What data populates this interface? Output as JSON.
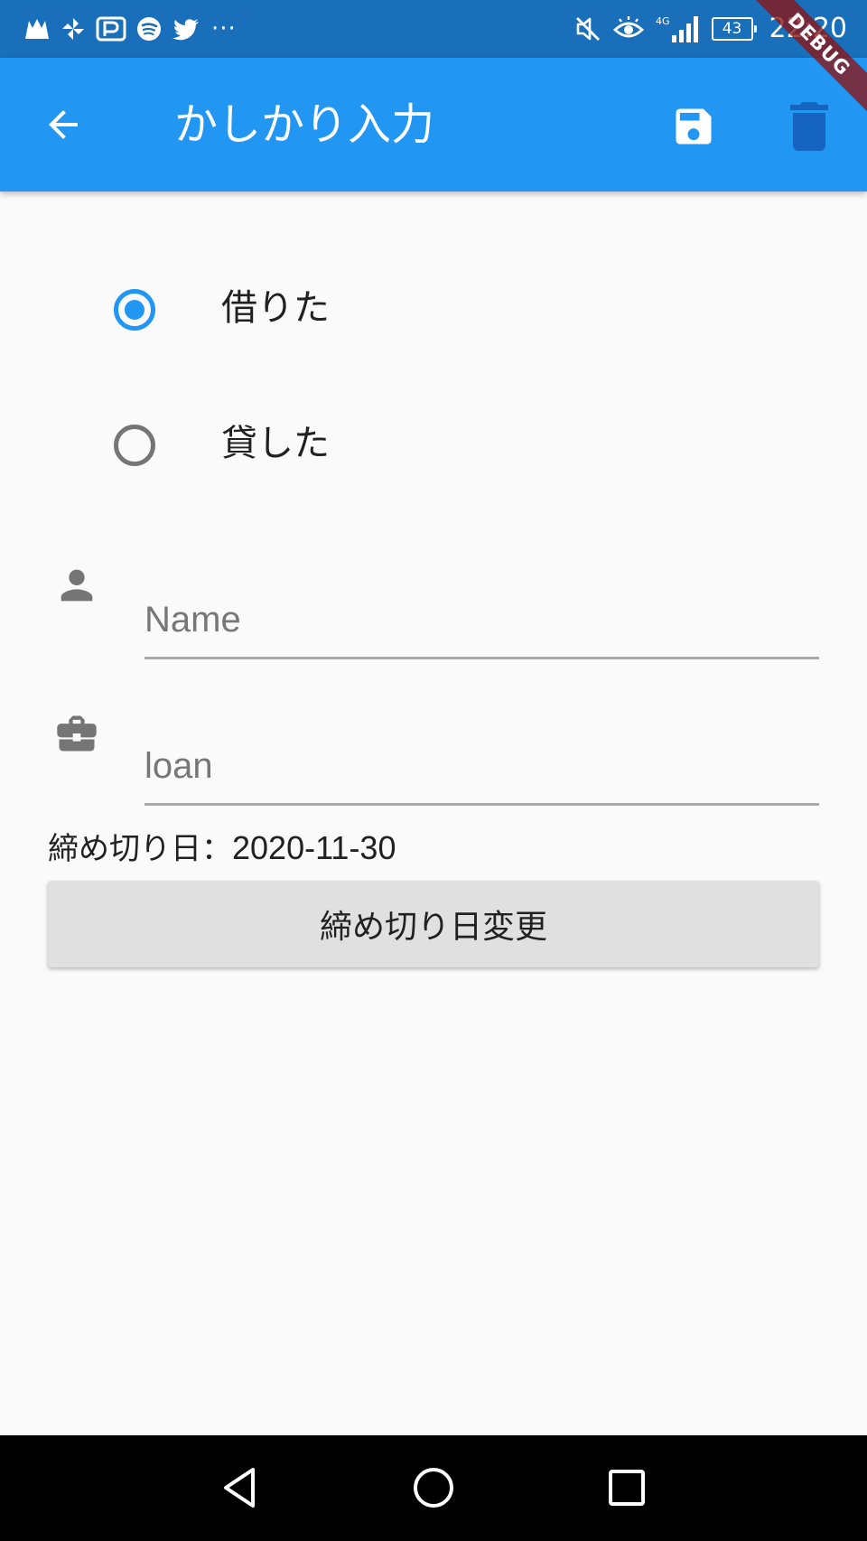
{
  "status_bar": {
    "time": "22:20",
    "battery": "43",
    "network": "4G",
    "more_indicator": "···",
    "left_icons": [
      "app-notification-icon",
      "pinwheel-icon",
      "paypay-icon",
      "spotify-icon",
      "twitter-icon"
    ],
    "right_icons": [
      "mute-icon",
      "eye-comfort-icon",
      "signal-icon",
      "battery-icon"
    ]
  },
  "app_bar": {
    "title": "かしかり入力",
    "back_icon": "arrow-back-icon",
    "save_icon": "save-icon",
    "delete_icon": "delete-icon",
    "color": "#2196f3"
  },
  "debug_banner": "DEBUG",
  "radio_group": {
    "options": [
      {
        "label": "借りた",
        "selected": true
      },
      {
        "label": "貸した",
        "selected": false
      }
    ],
    "accent_color": "#2196f3"
  },
  "form": {
    "name_field": {
      "placeholder": "Name",
      "value": "",
      "icon": "person-icon"
    },
    "loan_field": {
      "placeholder": "loan",
      "value": "",
      "icon": "briefcase-icon"
    }
  },
  "deadline": {
    "label": "締め切り日：",
    "value": "2020-11-30",
    "button_label": "締め切り日変更"
  },
  "nav_bar": {
    "buttons": [
      "back-triangle-icon",
      "home-circle-icon",
      "recents-square-icon"
    ]
  }
}
